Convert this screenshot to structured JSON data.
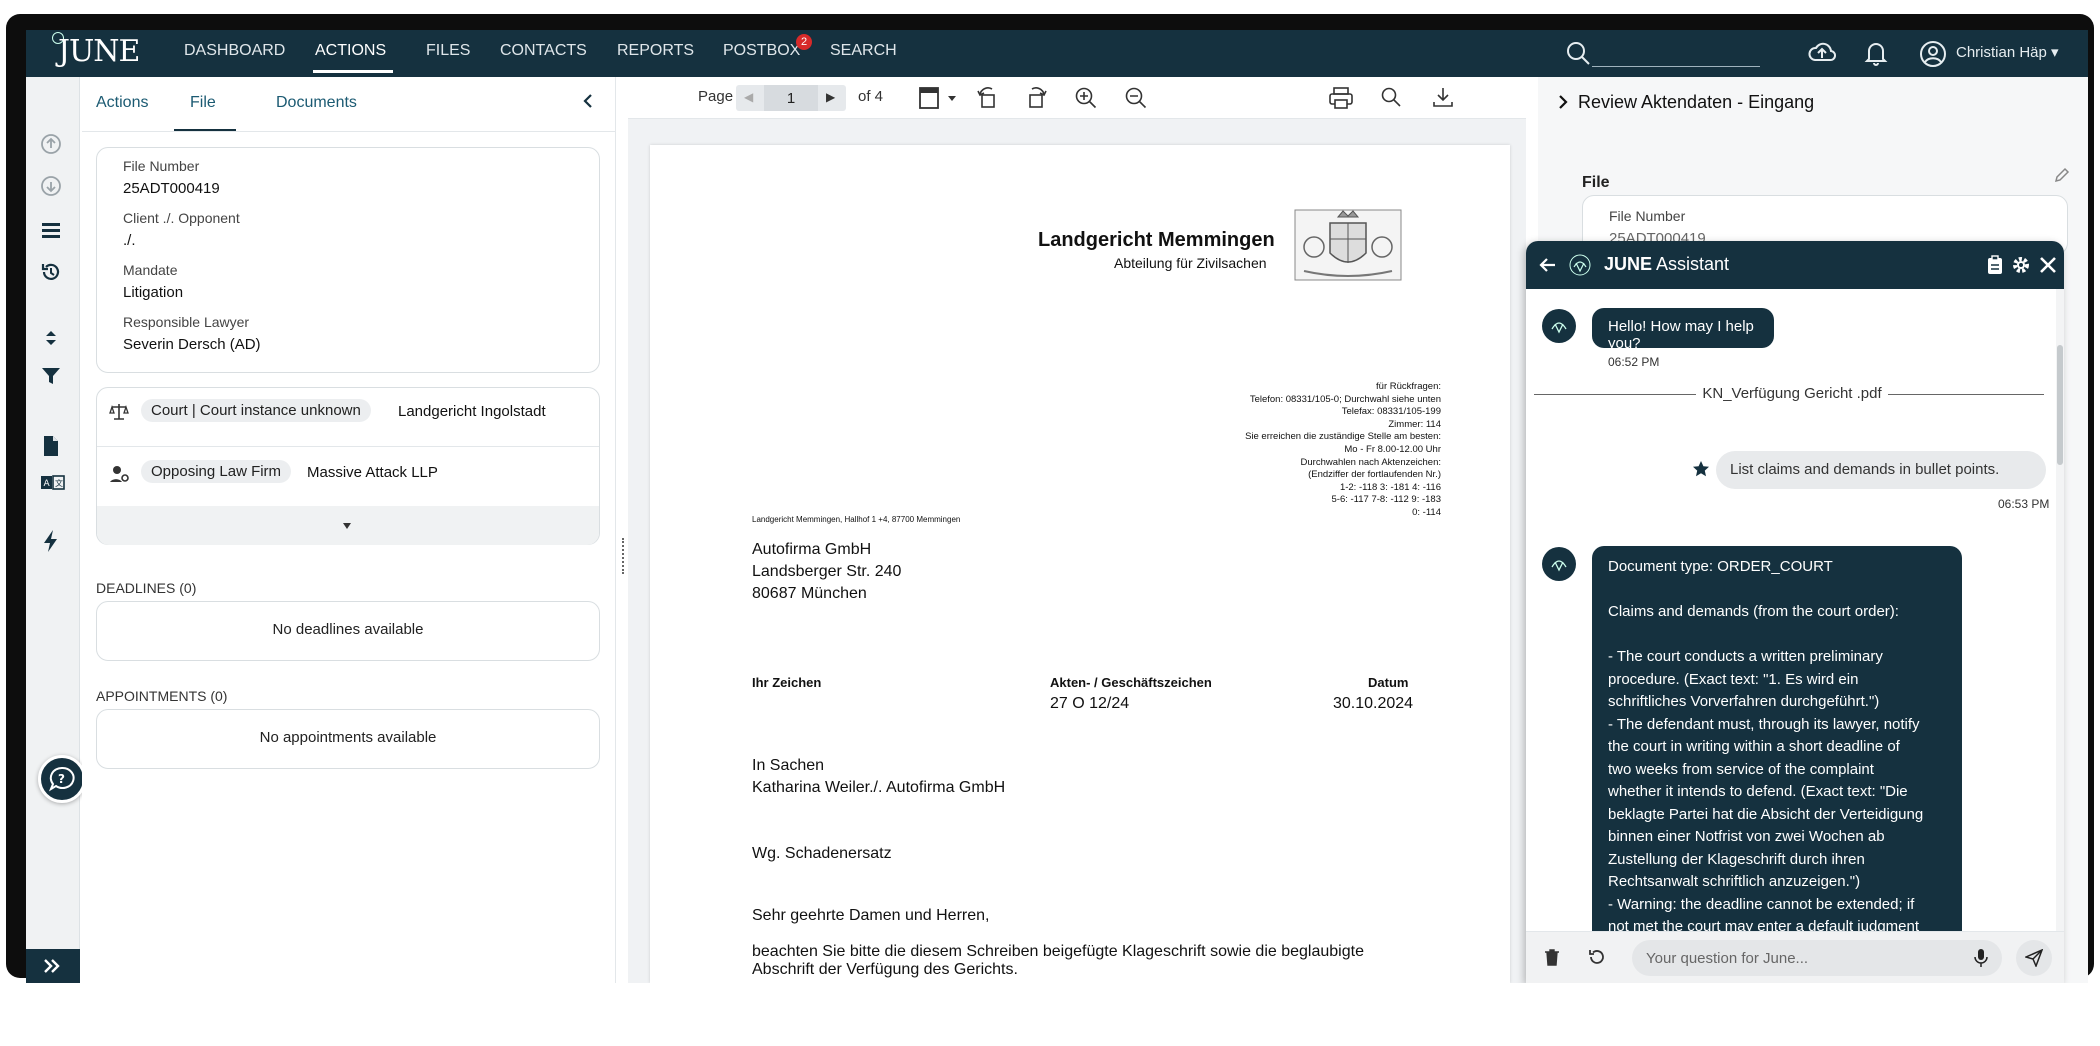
{
  "app": {
    "logo": "JUNE",
    "nav": [
      "DASHBOARD",
      "ACTIONS",
      "FILES",
      "CONTACTS",
      "REPORTS",
      "POSTBOX",
      "SEARCH"
    ],
    "postbox_badge": "2",
    "user_name": "Christian Häp",
    "accent_color": "#15313f"
  },
  "left_panel": {
    "tabs": [
      "Actions",
      "File",
      "Documents"
    ],
    "active_tab": "File",
    "file_info": {
      "file_number_label": "File Number",
      "file_number": "25ADT000419",
      "client_label": "Client ./. Opponent",
      "client_value": "./.",
      "mandate_label": "Mandate",
      "mandate_value": "Litigation",
      "lawyer_label": "Responsible Lawyer",
      "lawyer_value": "Severin Dersch (AD)"
    },
    "parties": {
      "court_chip": "Court | Court instance unknown",
      "court_value": "Landgericht Ingolstadt",
      "firm_chip": "Opposing Law Firm",
      "firm_value": "Massive Attack LLP"
    },
    "deadlines_title": "DEADLINES (0)",
    "deadlines_empty": "No deadlines available",
    "appointments_title": "APPOINTMENTS (0)",
    "appointments_empty": "No appointments available"
  },
  "viewer": {
    "page_label": "Page",
    "page_value": "1",
    "page_total": "of 4",
    "document": {
      "court_name": "Landgericht Memmingen",
      "court_dept": "Abteilung für Zivilsachen",
      "contact_lines": [
        "für Rückfragen:",
        "Telefon: 08331/105-0; Durchwahl siehe unten",
        "Telefax: 08331/105-199",
        "Zimmer: 114",
        "Sie erreichen die zuständige Stelle am besten:",
        "Mo - Fr 8.00-12.00 Uhr",
        "Durchwahlen nach Aktenzeichen:",
        "(Endziffer der fortlaufenden Nr.)",
        "1-2: -118     3: -181   4: -116",
        "5-6: -117   7-8: -112   9: -183",
        "0: -114"
      ],
      "sender_line": "Landgericht Memmingen, Hallhof 1 +4, 87700 Memmingen",
      "address": [
        "Autofirma GmbH",
        "Landsberger Str. 240",
        "80687 München"
      ],
      "ihr_zeichen_label": "Ihr Zeichen",
      "akten_label": "Akten- / Geschäftszeichen",
      "akten_value": "27 O 12/24",
      "datum_label": "Datum",
      "datum_value": "30.10.2024",
      "in_sachen_1": "In Sachen",
      "in_sachen_2": "Katharina Weiler./. Autofirma GmbH",
      "subject": "Wg. Schadenersatz",
      "greeting": "Sehr geehrte Damen und Herren,",
      "body_1": "beachten Sie bitte die diesem Schreiben beigefügte Klageschrift sowie die beglaubigte",
      "body_2": "Abschrift der Verfügung des Gerichts."
    }
  },
  "right_panel": {
    "review_title": "Review Aktendaten - Eingang",
    "file_label": "File",
    "file_number_label": "File Number",
    "file_number_value": "25ADT000419"
  },
  "assistant": {
    "title_bold": "JUNE",
    "title_rest": " Assistant",
    "greeting": "Hello! How may I help you?",
    "greeting_time": "06:52 PM",
    "doc_divider": "KN_Verfügung Gericht .pdf",
    "user_message": "List claims and demands in bullet points.",
    "user_time": "06:53 PM",
    "response_lines": [
      "Document type: ORDER_COURT",
      "",
      "Claims and demands (from the court order):",
      "",
      "- The court conducts a written preliminary",
      "procedure. (Exact text: \"1. Es wird ein",
      "schriftliches Vorverfahren durchgeführt.\")",
      "- The defendant must, through its lawyer, notify",
      "the court in writing within a short deadline of",
      "two weeks from service of the complaint",
      "whether it intends to defend. (Exact text: \"Die",
      "beklagte Partei hat die Absicht der Verteidigung",
      "binnen einer Notfrist von zwei Wochen ab",
      "Zustellung der Klageschrift durch ihren",
      "Rechtsanwalt schriftlich anzuzeigen.\")",
      "- Warning: the deadline cannot be extended; if",
      "not met the court may enter a default judgment"
    ],
    "input_placeholder": "Your question for June..."
  }
}
